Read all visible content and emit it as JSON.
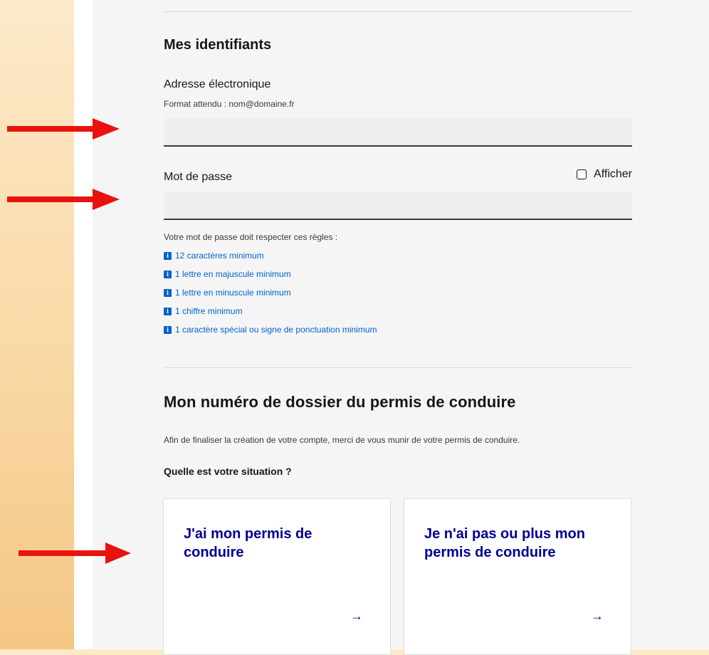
{
  "credentials": {
    "title": "Mes identifiants",
    "email": {
      "label": "Adresse électronique",
      "hint": "Format attendu : nom@domaine.fr",
      "value": "",
      "placeholder": ""
    },
    "password": {
      "label": "Mot de passe",
      "show_label": "Afficher",
      "value": "",
      "placeholder": ""
    },
    "rules_intro": "Votre mot de passe doit respecter ces règles :",
    "rules": [
      "12 caractères minimum",
      "1 lettre en majuscule minimum",
      "1 lettre en minuscule minimum",
      "1 chiffre minimum",
      "1 caractère spécial ou signe de ponctuation minimum"
    ],
    "rule_icon": "info-icon"
  },
  "license": {
    "title": "Mon numéro de dossier du permis de conduire",
    "intro": "Afin de finaliser la création de votre compte, merci de vous munir de votre permis de conduire.",
    "question": "Quelle est votre situation ?",
    "tiles": [
      {
        "title": "J'ai mon permis de conduire",
        "arrow": "→"
      },
      {
        "title": "Je n'ai pas ou plus mon permis de conduire",
        "arrow": "→"
      }
    ]
  },
  "annotations": {
    "arrow_color": "#e8130e"
  },
  "colors": {
    "accent": "#000091",
    "link": "#0063cb",
    "text": "#161616",
    "panel_bg": "#f5f5f5",
    "input_bg": "#eeeeee"
  }
}
